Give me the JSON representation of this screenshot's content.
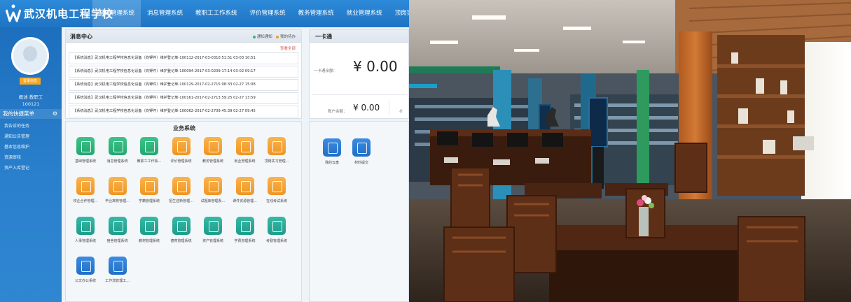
{
  "app": {
    "school_name": "武汉机电工程学校",
    "nav": [
      "基础管理系统",
      "消息管理系统",
      "教职工工作系统",
      "评价管理系统",
      "教务管理系统",
      "就业管理系统",
      "顶岗实习管理系统"
    ]
  },
  "sidebar": {
    "avatar_tag": "登录信息",
    "user_role": "概述 教职工",
    "user_id": "100121",
    "quick_title": "我的快捷菜单",
    "items": [
      "我告诉的任务",
      "通知公告管理",
      "基本信息维护",
      "资源审核",
      "资产入库登记"
    ]
  },
  "messages": {
    "title": "消息中心",
    "legend_unread": "通知通知",
    "legend_read": "我的待办",
    "view_all": "查看全部",
    "rows": [
      "【系统消息】武汉机电工程学校信息化设备（钧钾件）维护登记单-100112-2017-03-0310:51:51   03-03 10:51",
      "【系统消息】武汉机电工程学校信息化设备（钧钾件）维护登记单-100094-2017-03-0209:17:14   03-02 09:17",
      "【系统消息】武汉机电工程学校信息化设备（钧钾件）维护登记单-100129-2017-02-2715:08:33   02-27 15:08",
      "【系统消息】武汉机电工程学校信息化设备（钧钾件）维护登记单-100161-2017-02-2713:59:25   02-27 13:59",
      "【系统消息】武汉机电工程学校信息化设备（钧钾件）维护登记单-100062-2017-02-2709:45:39   02-27 09:45"
    ]
  },
  "business": {
    "title": "业务系统",
    "tiles": [
      {
        "label": "基础管理系统",
        "color": "green"
      },
      {
        "label": "消息管理系统",
        "color": "green"
      },
      {
        "label": "教职工工作系...",
        "color": "green"
      },
      {
        "label": "评价管理系统",
        "color": "orange"
      },
      {
        "label": "教务管理系统",
        "color": "orange"
      },
      {
        "label": "就业管理系统",
        "color": "orange"
      },
      {
        "label": "顶岗实习管理...",
        "color": "orange"
      },
      {
        "label": "校企合作管理...",
        "color": "orange"
      },
      {
        "label": "毕业离校管理...",
        "color": "orange"
      },
      {
        "label": "学籍管理系统",
        "color": "orange"
      },
      {
        "label": "招生迎新管理...",
        "color": "orange"
      },
      {
        "label": "试题库管理系...",
        "color": "orange"
      },
      {
        "label": "课件资源管理...",
        "color": "orange"
      },
      {
        "label": "在线考试系统",
        "color": "orange"
      },
      {
        "label": "人事管理系统",
        "color": "teal"
      },
      {
        "label": "宿舍管理系统",
        "color": "teal"
      },
      {
        "label": "教材管理系统",
        "color": "teal"
      },
      {
        "label": "德育管理系统",
        "color": "teal"
      },
      {
        "label": "资产管理系统",
        "color": "teal"
      },
      {
        "label": "学费管理系统",
        "color": "teal"
      },
      {
        "label": "考勤管理系统",
        "color": "teal"
      },
      {
        "label": "公文办公系统",
        "color": "blue"
      },
      {
        "label": "工作流管理工...",
        "color": "blue"
      }
    ]
  },
  "card": {
    "title": "一卡通",
    "balance1_label": "一卡通余额：",
    "balance1": "¥ 0.00",
    "balance2_label": "账户余额：",
    "balance2": "¥ 0.00",
    "extra_label": "补"
  },
  "apps": {
    "tiles": [
      {
        "label": "我的云盘",
        "color": "blue"
      },
      {
        "label": "材料提交",
        "color": "blue"
      }
    ]
  },
  "colors": {
    "header_blue": "#1f74c4",
    "sidebar_blue": "#2a80cc",
    "green": "#22a86e",
    "orange": "#f0951f",
    "teal": "#1d9d8b",
    "blue": "#1f6fc8"
  }
}
